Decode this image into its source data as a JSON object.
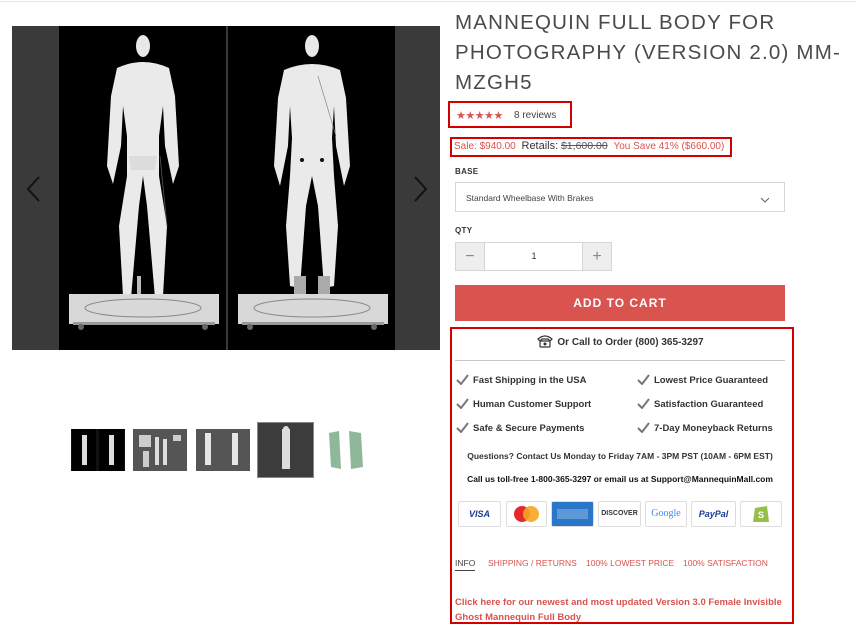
{
  "product": {
    "title": "MANNEQUIN FULL BODY FOR PHOTOGRAPHY (VERSION 2.0) MM-MZGH5",
    "stars": "★★★★★",
    "rating": 5,
    "reviews_label": "8 reviews",
    "sale_price": "Sale: $940.00",
    "retail_label": "Retails:",
    "retail_price": "$1,600.00",
    "savings": "You Save 41% ($660.00)"
  },
  "options": {
    "base_label": "BASE",
    "base_selected": "Standard Wheelbase With Brakes",
    "qty_label": "QTY",
    "qty_value": "1",
    "minus": "−",
    "plus": "+"
  },
  "cart": {
    "add_label": "ADD TO CART"
  },
  "gallery": {
    "thumbnail_count": 5,
    "active_thumbnail": 4
  },
  "info": {
    "call_text": "Or Call to Order (800) 365-3297",
    "features_left": [
      "Fast Shipping in the USA",
      "Human Customer Support",
      "Safe & Secure Payments"
    ],
    "features_right": [
      "Lowest Price Guaranteed",
      "Satisfaction Guaranteed",
      "7-Day Moneyback Returns"
    ],
    "questions": "Questions? Contact Us Monday to Friday 7AM - 3PM PST (10AM - 6PM EST)",
    "tollfree": "Call us toll-free 1-800-365-3297 or email us at Support@MannequinMall.com",
    "payments": [
      "VISA",
      "MasterCard",
      "AMERICAN EXPRESS",
      "DISCOVER",
      "Google",
      "PayPal",
      "Shopify"
    ],
    "tabs": [
      "INFO",
      "SHIPPING / RETURNS",
      "100% LOWEST PRICE",
      "100% SATISFACTION"
    ],
    "promo_link": "Click here for our newest and most updated Version 3.0 Female Invisible Ghost Mannequin Full Body"
  },
  "colors": {
    "accent": "#d9534f",
    "highlight_box": "#d40000",
    "text": "#333333"
  }
}
